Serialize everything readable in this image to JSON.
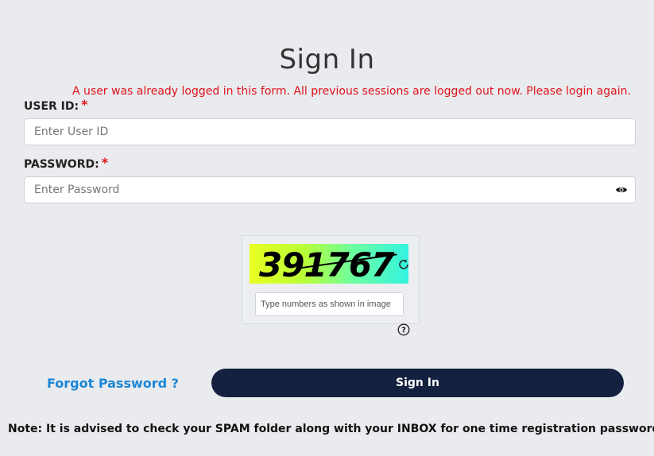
{
  "page": {
    "title": "Sign In",
    "session_error": "A user was already logged in this form. All previous sessions are logged out now. Please login again."
  },
  "form": {
    "user_id": {
      "label": "USER ID:",
      "required_mark": "*",
      "placeholder": "Enter User ID",
      "value": ""
    },
    "password": {
      "label": "PASSWORD:",
      "required_mark": "*",
      "placeholder": "Enter Password",
      "value": "",
      "toggle_icon": "eye-icon"
    },
    "captcha": {
      "code": "391767",
      "placeholder": "Type numbers as shown in image",
      "value": "",
      "refresh_icon": "refresh-icon",
      "help_icon": "help-icon",
      "gradient_colors": [
        "#e8ff1f",
        "#33f3e0"
      ]
    },
    "forgot_password_label": "Forgot Password ?",
    "submit_label": "Sign In"
  },
  "footer": {
    "note": "Note: It is advised to check your SPAM folder along with your INBOX for one time registration password."
  },
  "colors": {
    "background": "#e9ebee",
    "error": "#e0141b",
    "link": "#1a86d6",
    "button_bg": "#14203f",
    "button_text": "#ffffff"
  }
}
